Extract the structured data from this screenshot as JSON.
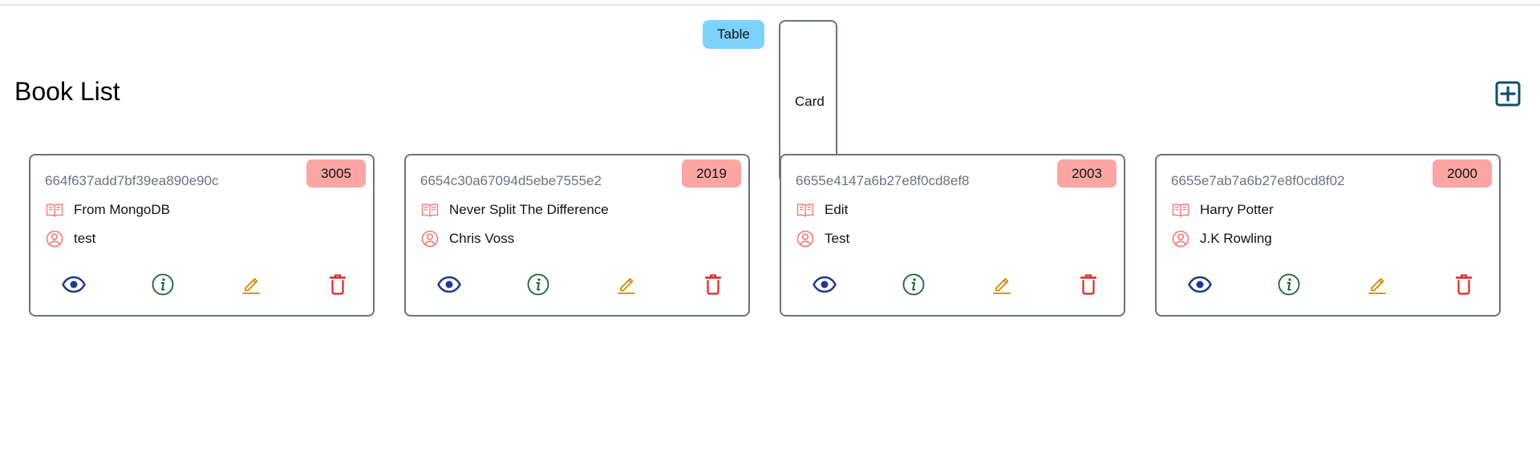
{
  "view_toggle": {
    "table_label": "Table",
    "card_label": "Card"
  },
  "page_title": "Book List",
  "colors": {
    "toggle_bg": "#7dd3fc",
    "badge_bg": "#fca5a5",
    "add_icon": "#0b4f6c",
    "show_icon": "#1e3a8a",
    "info_icon": "#166534",
    "edit_icon": "#ca8a04",
    "delete_icon": "#dc2626",
    "card_meta_icon": "#f87171"
  },
  "icons": {
    "add": "plus-square-icon",
    "title": "open-book-icon",
    "author": "user-circle-icon",
    "show": "eye-icon",
    "info": "info-circle-icon",
    "edit": "pencil-icon",
    "delete": "trash-icon"
  },
  "books": [
    {
      "id": "664f637add7bf39ea890e90c",
      "year": "3005",
      "title": "From MongoDB",
      "author": "test"
    },
    {
      "id": "6654c30a67094d5ebe7555e2",
      "year": "2019",
      "title": "Never Split The Difference",
      "author": "Chris Voss"
    },
    {
      "id": "6655e4147a6b27e8f0cd8ef8",
      "year": "2003",
      "title": "Edit",
      "author": "Test"
    },
    {
      "id": "6655e7ab7a6b27e8f0cd8f02",
      "year": "2000",
      "title": "Harry Potter",
      "author": "J.K Rowling"
    }
  ]
}
